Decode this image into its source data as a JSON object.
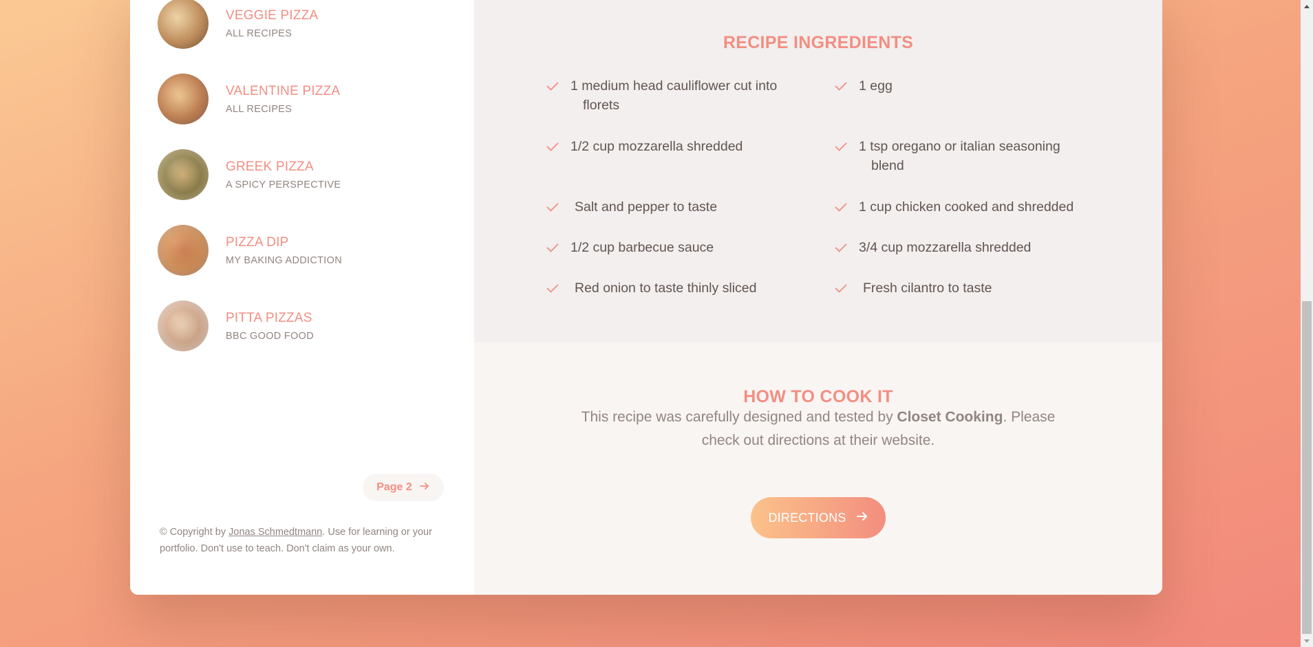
{
  "results": [
    {
      "title": "VEGGIE PIZZA",
      "publisher": "ALL RECIPES"
    },
    {
      "title": "VALENTINE PIZZA",
      "publisher": "ALL RECIPES"
    },
    {
      "title": "GREEK PIZZA",
      "publisher": "A SPICY PERSPECTIVE"
    },
    {
      "title": "PIZZA DIP",
      "publisher": "MY BAKING ADDICTION"
    },
    {
      "title": "PITTA PIZZAS",
      "publisher": "BBC GOOD FOOD"
    }
  ],
  "pagination": {
    "next_label": "Page 2"
  },
  "copyright": {
    "prefix": "© Copyright by ",
    "author": "Jonas Schmedtmann",
    "suffix": ". Use for learning or your portfolio. Don't use to teach. Don't claim as your own."
  },
  "ingredients": {
    "title": "RECIPE INGREDIENTS",
    "items": [
      "1 medium head cauliflower cut into florets",
      "1 egg",
      "1/2 cup mozzarella shredded",
      "1 tsp oregano or italian seasoning blend",
      " Salt and pepper to taste",
      "1 cup chicken cooked and shredded",
      "1/2 cup barbecue sauce",
      "3/4 cup mozzarella shredded",
      " Red onion to taste thinly sliced",
      " Fresh cilantro to taste"
    ]
  },
  "cook": {
    "title": "HOW TO COOK IT",
    "text_before": "This recipe was carefully designed and tested by ",
    "publisher": "Closet Cooking",
    "text_after": ". Please check out directions at their website.",
    "button_label": "DIRECTIONS"
  },
  "colors": {
    "accent": "#f38e82",
    "text": "#615551",
    "muted": "#918581",
    "ingredients_bg": "#f2efee",
    "cook_bg": "#f9f5f3"
  },
  "icons": {
    "check": "check-icon",
    "arrow": "arrow-right-icon"
  }
}
